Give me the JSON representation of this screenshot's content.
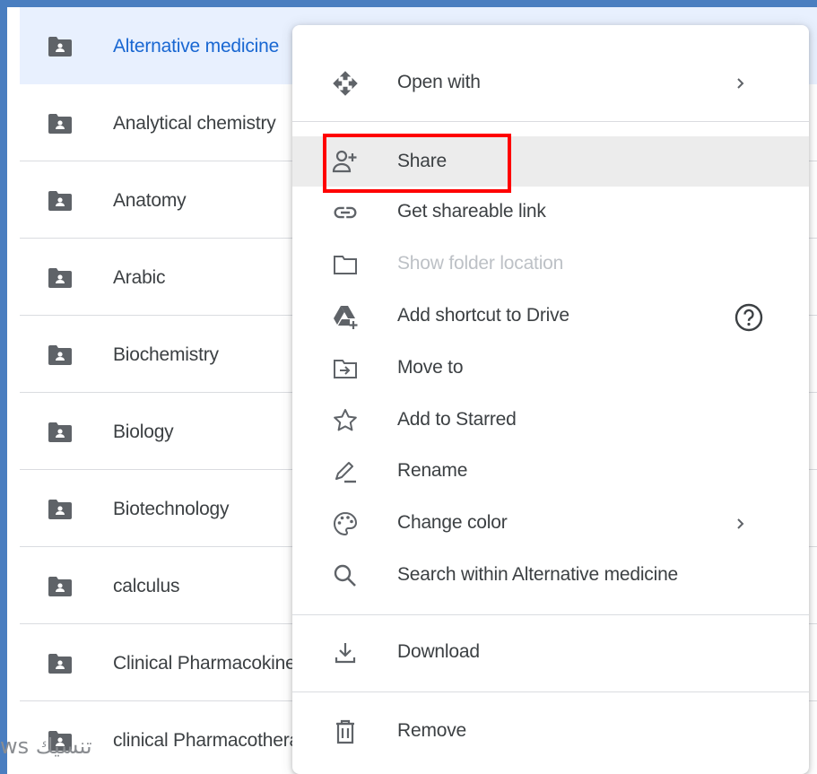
{
  "folders": [
    {
      "name": "Alternative medicine",
      "selected": true
    },
    {
      "name": "Analytical chemistry",
      "selected": false
    },
    {
      "name": "Anatomy",
      "selected": false
    },
    {
      "name": "Arabic",
      "selected": false
    },
    {
      "name": "Biochemistry",
      "selected": false
    },
    {
      "name": "Biology",
      "selected": false
    },
    {
      "name": "Biotechnology",
      "selected": false
    },
    {
      "name": "calculus",
      "selected": false
    },
    {
      "name": "Clinical Pharmacokinetics",
      "selected": false
    },
    {
      "name": "clinical Pharmacotherapy",
      "selected": false
    }
  ],
  "context_menu": {
    "open_with": {
      "label": "Open with",
      "icon": "move-arrows-icon"
    },
    "share": {
      "label": "Share",
      "icon": "person-add-icon"
    },
    "get_link": {
      "label": "Get shareable link",
      "icon": "link-icon"
    },
    "show_location": {
      "label": "Show folder location",
      "icon": "folder-outline-icon"
    },
    "add_shortcut": {
      "label": "Add shortcut to Drive",
      "icon": "drive-shortcut-icon"
    },
    "move_to": {
      "label": "Move to",
      "icon": "move-to-folder-icon"
    },
    "add_starred": {
      "label": "Add to Starred",
      "icon": "star-outline-icon"
    },
    "rename": {
      "label": "Rename",
      "icon": "pencil-icon"
    },
    "change_color": {
      "label": "Change color",
      "icon": "palette-icon"
    },
    "search_within": {
      "label": "Search within Alternative medicine",
      "icon": "search-icon"
    },
    "download": {
      "label": "Download",
      "icon": "download-icon"
    },
    "remove": {
      "label": "Remove",
      "icon": "trash-icon"
    }
  },
  "watermark": "ws تنسيك",
  "colors": {
    "selected_row": "#e8f0fe",
    "selected_text": "#1967d2",
    "highlight_box": "#ff0000",
    "frame_border": "#4a7ec0"
  }
}
